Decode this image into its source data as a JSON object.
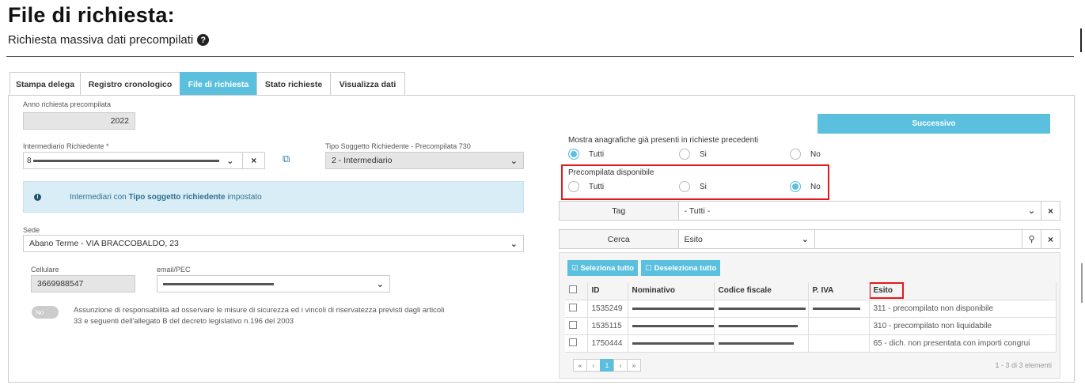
{
  "header": {
    "title": "File di richiesta:",
    "subtitle": "Richiesta massiva dati precompilati",
    "help_icon": "?"
  },
  "tabs": [
    {
      "label": "Stampa delega",
      "active": false
    },
    {
      "label": "Registro cronologico",
      "active": false
    },
    {
      "label": "File di richiesta",
      "active": true
    },
    {
      "label": "Stato richieste",
      "active": false
    },
    {
      "label": "Visualizza dati",
      "active": false
    }
  ],
  "form": {
    "anno_label": "Anno richiesta precompilata",
    "anno_value": "2022",
    "intermediario_label": "Intermediario Richiedente *",
    "intermediario_value": "8",
    "tipo_label": "Tipo Soggetto Richiedente - Precompilata 730",
    "tipo_value": "2 - Intermediario",
    "info_prefix": "Intermediari con ",
    "info_bold": "Tipo soggetto richiedente",
    "info_suffix": " impostato",
    "sede_label": "Sede",
    "sede_value": "Abano Terme - VIA BRACCOBALDO, 23",
    "cellulare_label": "Cellulare",
    "cellulare_value": "3669988547",
    "email_label": "email/PEC",
    "toggle_label": "No",
    "consent_text_1": "Assunzione di responsabilità ad osservare le misure di sicurezza ed i vincoli di riservatezza previsti dagli articoli",
    "consent_text_2": "33 e seguenti dell'allegato B del decreto legislativo n.196 del 2003"
  },
  "right": {
    "next_button": "Successivo",
    "mostra_label": "Mostra anagrafiche già presenti in richieste precedenti",
    "mostra_options": [
      "Tutti",
      "Si",
      "No"
    ],
    "mostra_selected": "Tutti",
    "precompilata_label": "Precompilata disponibile",
    "precompilata_options": [
      "Tutti",
      "Si",
      "No"
    ],
    "precompilata_selected": "No",
    "tag_label": "Tag",
    "tag_value": "- Tutti -",
    "cerca_label": "Cerca",
    "cerca_field": "Esito",
    "cerca_value": "",
    "select_all": "Seleziona tutto",
    "deselect_all": "Deseleziona tutto"
  },
  "table": {
    "columns": [
      "ID",
      "Nominativo",
      "Codice fiscale",
      "P. IVA",
      "Esito"
    ],
    "rows": [
      {
        "id": "1535249",
        "esito": "311 - precompilato non disponibile"
      },
      {
        "id": "1535115",
        "esito": "310 - precompilato non liquidabile"
      },
      {
        "id": "1750444",
        "esito": "65 - dich. non presentata con importi congrui"
      }
    ],
    "pagination": {
      "first": "«",
      "prev": "‹",
      "current": "1",
      "next": "›",
      "last": "»"
    },
    "summary": "1 - 3 di 3 elementi"
  },
  "colors": {
    "accent": "#5bc0de",
    "highlight": "#e31a1c",
    "info_bg": "#d9edf7"
  }
}
